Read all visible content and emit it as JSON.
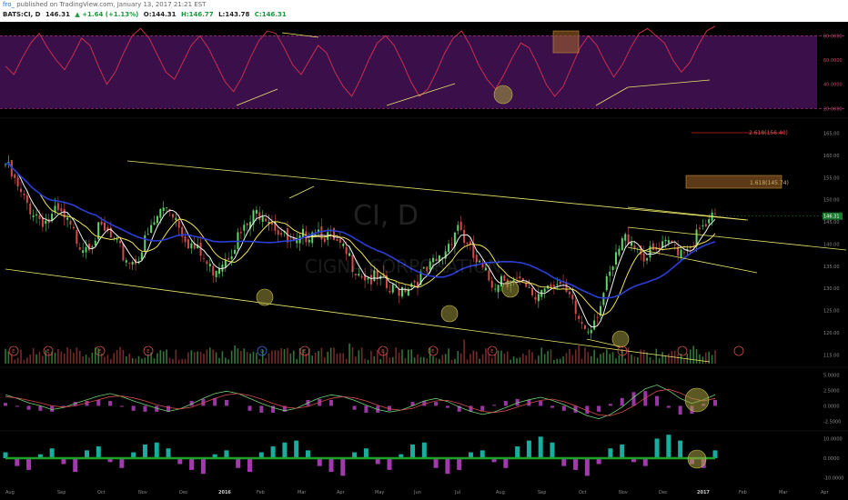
{
  "header": {
    "user": "fro_",
    "published": "published on TradingView.com, January 13, 2017 21:21 EST",
    "symbol": "BATS:CI, D",
    "last": "146.31",
    "change": "▲ +1.64 (+1.13%)",
    "open": "O:144.31",
    "high": "H:146.77",
    "low": "L:143.78",
    "close": "C:146.31"
  },
  "watermark": {
    "ticker": "CI, D",
    "name": "CIGNA CORPORATION"
  },
  "colors": {
    "background": "#000000",
    "rsi_band": "#3a0f4a",
    "rsi_line": "#d8324e",
    "price_up": "#5fd46a",
    "price_down": "#d14c4c",
    "ma_white": "#f2f2f2",
    "ma_yellow": "#f0e05a",
    "ma_blue": "#2b3fd8",
    "trendline": "#e8e56c",
    "macd_hist": "#b43fbf",
    "macd_hist2_up": "#19c0b0",
    "fib_line": "#c22"
  },
  "chart_data": [
    {
      "type": "line",
      "name": "RSI",
      "y_axis_ticks": [
        "80.0000",
        "60.0000",
        "40.0000",
        "20.0000"
      ],
      "ylim": [
        15,
        90
      ],
      "overbought": 80,
      "oversold": 20,
      "values": [
        55,
        48,
        62,
        74,
        82,
        70,
        60,
        52,
        64,
        78,
        72,
        55,
        40,
        50,
        66,
        80,
        86,
        78,
        64,
        50,
        44,
        58,
        72,
        80,
        70,
        56,
        42,
        34,
        46,
        62,
        76,
        84,
        82,
        70,
        56,
        48,
        60,
        72,
        66,
        50,
        38,
        30,
        44,
        60,
        74,
        80,
        72,
        58,
        42,
        30,
        36,
        50,
        66,
        78,
        84,
        72,
        56,
        44,
        36,
        48,
        62,
        74,
        70,
        56,
        40,
        30,
        38,
        54,
        70,
        80,
        72,
        58,
        46,
        56,
        70,
        82,
        86,
        80,
        74,
        60,
        50,
        58,
        72,
        84,
        88
      ]
    },
    {
      "type": "candlestick",
      "name": "BATS:CI, D",
      "x_tick_labels": [
        "Aug",
        "Sep",
        "Oct",
        "Nov",
        "Dec",
        "2016",
        "Feb",
        "Mar",
        "Apr",
        "May",
        "Jun",
        "Jul",
        "Aug",
        "Sep",
        "Oct",
        "Nov",
        "Dec",
        "2017",
        "Feb",
        "Mar",
        "Apr"
      ],
      "y_axis_ticks": [
        "165.00",
        "160.00",
        "155.00",
        "150.00",
        "145.00",
        "140.00",
        "135.00",
        "130.00",
        "125.00",
        "120.00",
        "115.00"
      ],
      "ylim": [
        113,
        168
      ],
      "last_price": "146.31",
      "close_path": [
        158,
        154,
        150,
        148,
        146,
        145,
        147,
        145,
        142,
        140,
        141,
        143,
        142,
        139,
        137,
        136,
        139,
        143,
        147,
        149,
        146,
        142,
        139,
        137,
        134,
        136,
        138,
        141,
        143,
        146,
        148,
        146,
        143,
        140,
        139,
        142,
        144,
        143,
        141,
        139,
        137,
        135,
        133,
        132,
        131,
        129,
        130,
        131,
        132,
        133,
        135,
        137,
        141,
        145,
        139,
        136,
        133,
        131,
        133,
        132,
        131,
        129,
        128,
        131,
        132,
        130,
        127,
        123,
        121,
        124,
        129,
        134,
        140,
        142,
        139,
        137,
        138,
        139,
        140,
        139,
        140,
        142,
        144,
        146
      ],
      "annotations": {
        "fib_2618": "2.618(156.40)",
        "fib_1618": "1.618(145.74)"
      },
      "earnings_markers": [
        "E",
        "E",
        "E",
        "E",
        "D",
        "E",
        "E",
        "E",
        "E",
        "E"
      ]
    },
    {
      "type": "line",
      "name": "MACD",
      "y_axis_ticks": [
        "5.0000",
        "2.5000",
        "0.0000",
        "-2.5000"
      ],
      "ylim": [
        -3.5,
        6
      ],
      "macd": [
        1.8,
        1.2,
        0.5,
        0.0,
        -0.6,
        -0.3,
        0.4,
        1.0,
        1.6,
        2.0,
        1.5,
        0.8,
        0.2,
        -0.4,
        -0.9,
        -0.5,
        0.3,
        1.2,
        2.0,
        2.4,
        2.0,
        1.2,
        0.4,
        -0.3,
        -0.8,
        -0.4,
        0.5,
        1.3,
        1.8,
        1.5,
        0.9,
        0.1,
        -0.6,
        -1.0,
        -0.7,
        0.0,
        0.8,
        1.2,
        0.7,
        -0.2,
        -0.9,
        -1.4,
        -1.0,
        -0.3,
        0.5,
        1.0,
        1.4,
        0.9,
        0.2,
        -0.7,
        -1.6,
        -2.1,
        -1.4,
        -0.2,
        1.4,
        2.8,
        3.4,
        2.5,
        1.2,
        0.4,
        1.0,
        1.8
      ],
      "signal": [
        1.5,
        1.3,
        0.9,
        0.5,
        0.0,
        -0.2,
        0.0,
        0.5,
        1.0,
        1.5,
        1.6,
        1.3,
        0.8,
        0.2,
        -0.3,
        -0.5,
        -0.2,
        0.5,
        1.2,
        1.8,
        2.0,
        1.7,
        1.1,
        0.4,
        -0.2,
        -0.4,
        -0.1,
        0.6,
        1.2,
        1.5,
        1.3,
        0.8,
        0.1,
        -0.5,
        -0.7,
        -0.4,
        0.3,
        0.8,
        0.9,
        0.4,
        -0.3,
        -0.9,
        -1.1,
        -0.8,
        -0.2,
        0.4,
        0.9,
        1.1,
        0.7,
        0.0,
        -0.8,
        -1.5,
        -1.6,
        -1.0,
        0.0,
        1.3,
        2.4,
        2.7,
        2.1,
        1.2,
        0.8,
        1.2
      ]
    },
    {
      "type": "bar",
      "name": "MACD histogram",
      "y_axis_ticks": [
        "10.0000",
        "0.0000",
        "-10.0000"
      ],
      "ylim": [
        -13,
        13
      ],
      "values": [
        3,
        -4,
        -6,
        2,
        5,
        -3,
        -7,
        4,
        6,
        -2,
        -5,
        3,
        7,
        8,
        5,
        -3,
        -6,
        -8,
        2,
        4,
        -5,
        -7,
        3,
        6,
        8,
        9,
        4,
        -4,
        -7,
        -9,
        3,
        5,
        -3,
        -6,
        2,
        7,
        8,
        -5,
        -8,
        -6,
        3,
        4,
        -2,
        -5,
        6,
        9,
        11,
        8,
        -4,
        -6,
        -9,
        -3,
        5,
        7,
        -2,
        -4,
        10,
        12,
        9,
        -3,
        -5,
        4
      ]
    }
  ]
}
